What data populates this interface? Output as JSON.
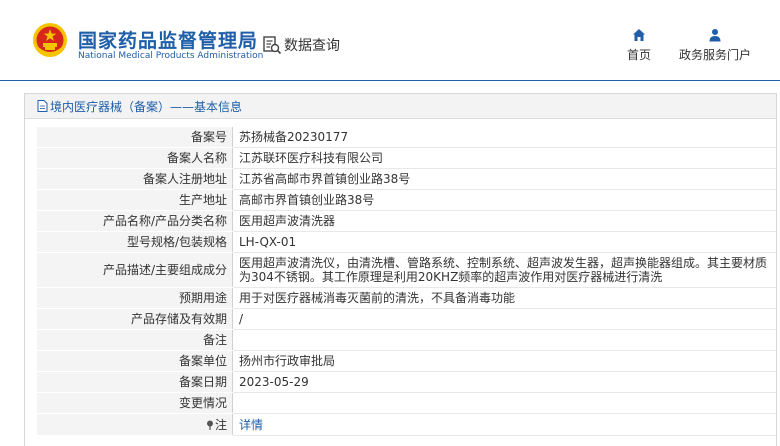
{
  "header": {
    "brand_cn": "国家药品监督管理局",
    "brand_en": "National Medical Products Administration",
    "data_query": "数据查询",
    "nav": [
      {
        "label": "首页",
        "icon": "home-icon"
      },
      {
        "label": "政务服务门户",
        "icon": "user-icon"
      }
    ]
  },
  "panel": {
    "title": "境内医疗器械（备案）——基本信息"
  },
  "rows": [
    {
      "label": "备案号",
      "value": "苏扬械备20230177"
    },
    {
      "label": "备案人名称",
      "value": "江苏联环医疗科技有限公司"
    },
    {
      "label": "备案人注册地址",
      "value": "江苏省高邮市界首镇创业路38号"
    },
    {
      "label": "生产地址",
      "value": "高邮市界首镇创业路38号"
    },
    {
      "label": "产品名称/产品分类名称",
      "value": "医用超声波清洗器"
    },
    {
      "label": "型号规格/包装规格",
      "value": "LH-QX-01"
    },
    {
      "label": "产品描述/主要组成成分",
      "value": "医用超声波清洗仪，由清洗槽、管路系统、控制系统、超声波发生器，超声换能器组成。其主要材质为304不锈钢。其工作原理是利用20KHZ频率的超声波作用对医疗器械进行清洗"
    },
    {
      "label": "预期用途",
      "value": "用于对医疗器械消毒灭菌前的清洗，不具备消毒功能"
    },
    {
      "label": "产品存储及有效期",
      "value": "/"
    },
    {
      "label": "备注",
      "value": ""
    },
    {
      "label": "备案单位",
      "value": "扬州市行政审批局"
    },
    {
      "label": "备案日期",
      "value": "2023-05-29"
    },
    {
      "label": "变更情况",
      "value": ""
    },
    {
      "label": "注",
      "value": "详情"
    }
  ],
  "colors": {
    "brand_blue": "#1f5ea8",
    "emblem_red": "#d7261b",
    "emblem_gold": "#f5c400"
  }
}
